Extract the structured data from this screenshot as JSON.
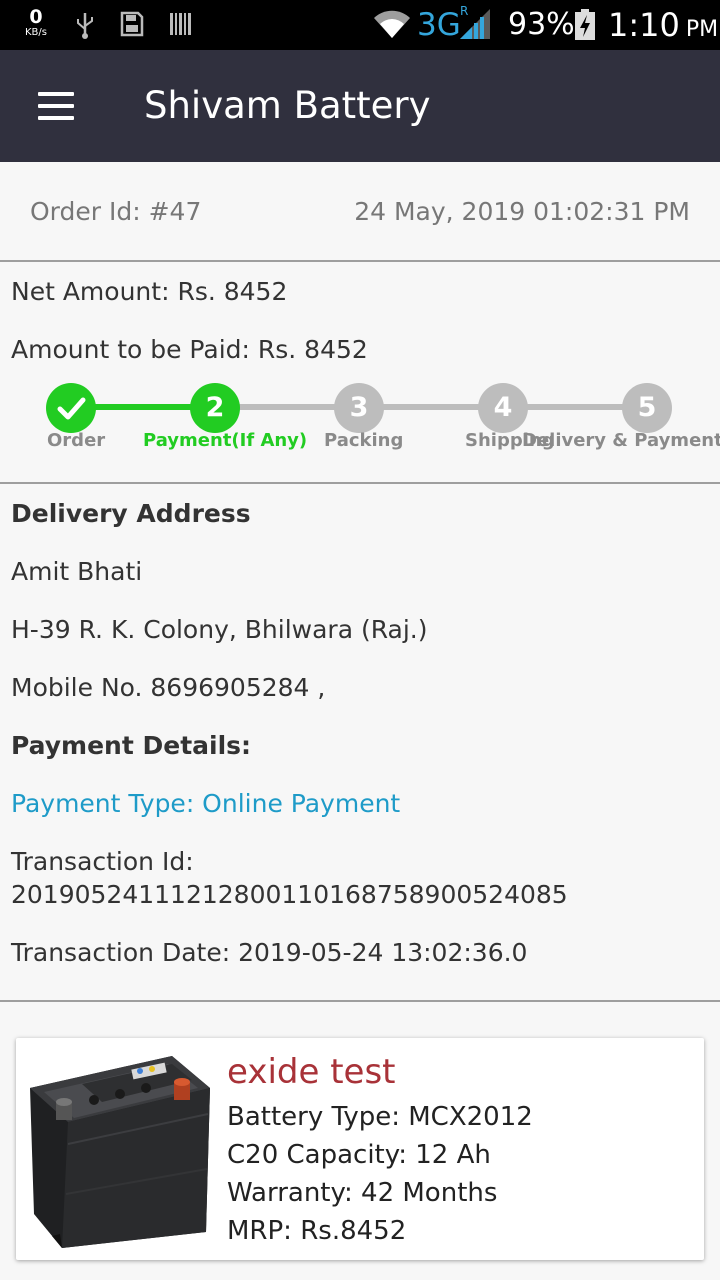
{
  "status_bar": {
    "net_speed": "0",
    "net_unit": "KB/s",
    "network": "3G",
    "roaming": "R",
    "battery": "93%",
    "time": "1:10",
    "ampm": "PM"
  },
  "app_bar": {
    "title": "Shivam Battery",
    "menu_icon": "hamburger-menu-icon"
  },
  "order": {
    "id_text": "Order Id: #47",
    "date_text": "24 May, 2019 01:02:31 PM",
    "net_amount": "Net Amount: Rs. 8452",
    "amount_to_pay": "Amount to be Paid: Rs. 8452"
  },
  "stepper": {
    "active_color": "#22cc22",
    "inactive_color": "#bdbdbd",
    "current_step": 2,
    "steps": [
      {
        "number": "1",
        "label": "Order",
        "state": "completed"
      },
      {
        "number": "2",
        "label": "Payment(If Any)",
        "state": "active"
      },
      {
        "number": "3",
        "label": "Packing",
        "state": "pending"
      },
      {
        "number": "4",
        "label": "Shipping",
        "state": "pending"
      },
      {
        "number": "5",
        "label": "Delivery & Payment (If",
        "state": "pending"
      }
    ]
  },
  "delivery": {
    "heading": "Delivery Address",
    "name": "Amit Bhati",
    "address": "H-39 R. K. Colony, Bhilwara (Raj.)",
    "mobile": "Mobile No. 8696905284 ,"
  },
  "payment": {
    "heading": "Payment Details:",
    "type": "Payment Type: Online Payment",
    "transaction_id_label": "Transaction Id:",
    "transaction_id": "20190524111212800110168758900524085",
    "transaction_date": "Transaction Date: 2019-05-24 13:02:36.0"
  },
  "product": {
    "name": "exide test",
    "battery_type": "Battery Type: MCX2012",
    "capacity": "C20 Capacity: 12 Ah",
    "warranty": "Warranty: 42 Months",
    "mrp": "MRP: Rs.8452",
    "image_icon": "car-battery-image"
  }
}
